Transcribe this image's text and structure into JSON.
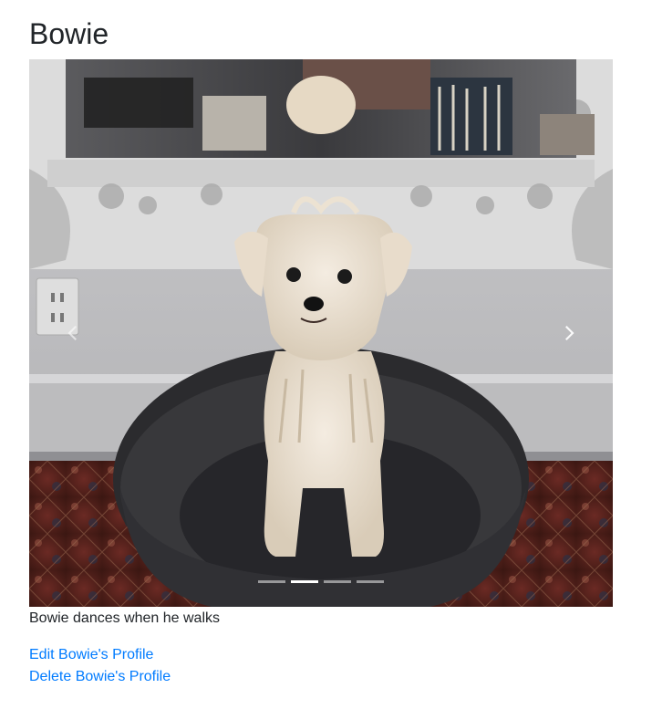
{
  "profile": {
    "name": "Bowie"
  },
  "carousel": {
    "image_alt": "Bowie",
    "caption": "Bowie dances when he walks",
    "slide_count": 4,
    "active_index": 1,
    "prev_icon": "chevron-left-icon",
    "next_icon": "chevron-right-icon"
  },
  "actions": {
    "edit_label": "Edit Bowie's Profile",
    "delete_label": "Delete Bowie's Profile"
  },
  "colors": {
    "link": "#007bff",
    "text": "#212529"
  }
}
